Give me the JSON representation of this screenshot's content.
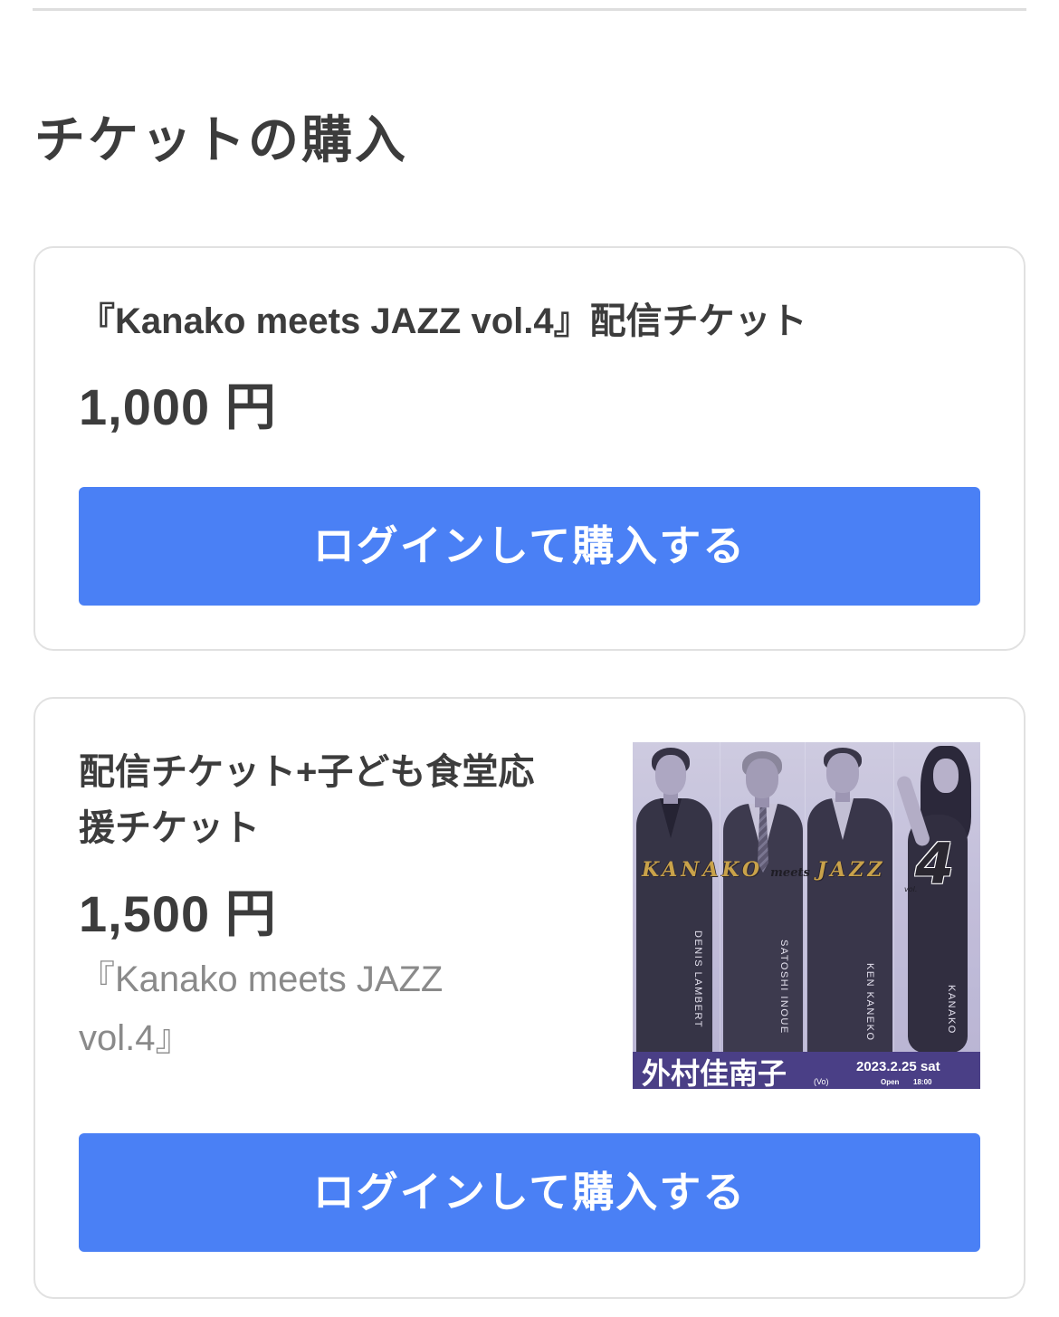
{
  "section_title": "チケットの購入",
  "tickets": [
    {
      "title": "『Kanako meets JAZZ vol.4』配信チケット",
      "price": "1,000 円",
      "button_label": "ログインして購入する"
    },
    {
      "title": "配信チケット+子ども食堂応援チケット",
      "price": "1,500 円",
      "description": "『Kanako meets JAZZ vol.4』",
      "button_label": "ログインして購入する",
      "poster": {
        "title_start": "KANAKO",
        "title_mid": "meets",
        "title_end": "JAZZ",
        "vol_label": "vol.",
        "vol_number": "4",
        "performers": [
          "DENIS LAMBERT",
          "SATOSHI INOUE",
          "KEN KANEKO",
          "KANAKO"
        ],
        "featured_name": "外村佳南子",
        "featured_role": "(Vo)",
        "date": "2023.2.25 sat",
        "open_label": "Open",
        "open_time": "18:00"
      }
    }
  ],
  "colors": {
    "accent": "#4a80f5",
    "text": "#3c3c3c",
    "muted": "#8a8a8a",
    "border": "#e1e1e1",
    "divider": "#dedede",
    "poster_band": "#4a3f86",
    "poster_title": "#c9a24a"
  }
}
